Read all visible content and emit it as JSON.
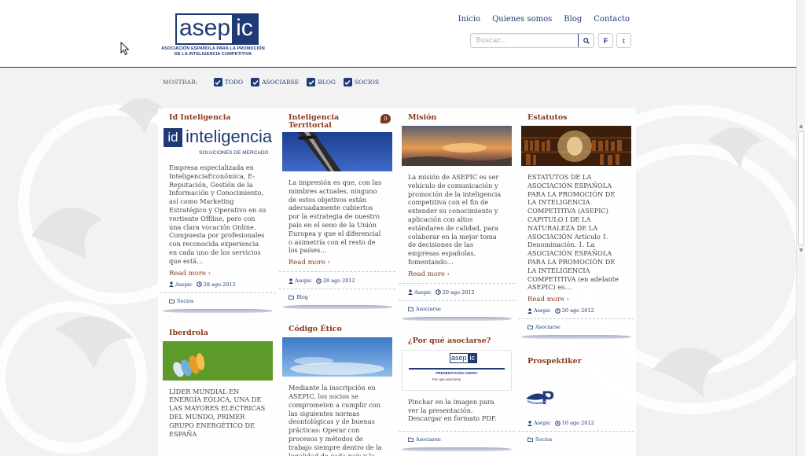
{
  "logo": {
    "part1": "asep",
    "part2": "ic",
    "subtitle": "ASOCIACIÓN ESPAÑOLA PARA LA PROMOCIÓN DE LA INTELIGENCIA COMPETITIVA"
  },
  "nav": {
    "items": [
      "Inicio",
      "Quienes somos",
      "Blog",
      "Contacto"
    ]
  },
  "search": {
    "placeholder": "Buscar..."
  },
  "social": {
    "facebook": "F",
    "twitter": "t"
  },
  "filters": {
    "label": "MOSTRAR:",
    "options": [
      "TODO",
      "ASOCIARSE",
      "BLOG",
      "SOCIOS"
    ]
  },
  "colors": {
    "brand": "#1f3a75",
    "title": "#8b3a1e"
  },
  "cards": {
    "id_inteligencia": {
      "title": "Id Inteligencia",
      "logo_id": "id",
      "logo_main": "inteligencia",
      "logo_sub": "SOLUCIONES DE MERCADO",
      "text": "Empresa especializada en InteligenciaEconómica, E-Reputación, Gestión de la Información y Conocimiento, así como Marketing Estratégico y Operativo en su vertiente Offline, pero con una clara vocación Online. Compuesta por profesionales con reconocida experiencia en cada uno de los servicios que está…",
      "readmore": "Read more ›",
      "author": "Asepic",
      "date": "28 ago 2012",
      "category": "Socios"
    },
    "iberdrola": {
      "title": "Iberdrola",
      "text": "LÍDER MUNDIAL EN ENERGÍA EÓLICA, UNA DE LAS MAYORES ELECTRICAS DEL MUNDO, PRIMER GRUPO ENERGÉTICO DE ESPAÑA"
    },
    "inteligencia_territorial": {
      "title": "Inteligencia Territorial",
      "comments": "0",
      "text": "La impresión es que, con las mimbres actuales, ninguno de estos objetivos están adecuadamente cubiertos por la estrategia de nuestro país en el seno de la Unión Europea y que el diferencial o asimetría con el resto de los países…",
      "readmore": "Read more ›",
      "author": "Asepic",
      "date": "28 ago 2012",
      "category": "Blog"
    },
    "codigo_etico": {
      "title": "Código Ético",
      "text": "Mediante la inscripción en ASEPIC, los socios se comprometen a cumplir con las siguientes normas deontológicas y de buenas prácticas: Operar con procesos y métodos de trabajo siempre dentro de la legalidad de cada país y la"
    },
    "mision": {
      "title": "Misión",
      "text": "La misión de ASEPIC es ser vehículo de comunicación y promoción de la inteligencia competitiva con el fin de extender su conocimiento y aplicación con altos estándares de calidad, para colaborar en la mejor toma de decisiones de las empresas españolas, fomentando…",
      "readmore": "Read more ›",
      "author": "Asepic",
      "date": "20 ago 2012",
      "category": "Asociarse"
    },
    "por_que": {
      "title": "¿Por qué asociarse?",
      "img_logo_a": "asep",
      "img_logo_b": "ic",
      "img_caption": "PRESENTACIÓN ASEPIC",
      "img_sub": "Por qué asociarse",
      "text": "Pinchar en la imagen para ver la presentación. Descargar en formato PDF.",
      "category": "Asociarse"
    },
    "estatutos": {
      "title": "Estatutos",
      "text": "ESTATUTOS DE LA ASOCIACIÓN ESPAÑOLA PARA LA PROMOCIÓN DE LA INTELIGENCIA COMPETITIVA (ASEPIC) CAPITULO I DE LA NATURALEZA DE LA ASOCIACIÓN   Artículo 1. Denominación. 1. La ASOCIACIÓN ESPAÑOLA PARA LA PROMOCIÓN DE LA INTELIGENCIA COMPETITIVA (en adelante ASEPIC) es…",
      "readmore": "Read more ›",
      "author": "Asepic",
      "date": "20 ago 2012",
      "category": "Asociarse"
    },
    "prospektiker": {
      "title": "Prospektiker",
      "author": "Asepic",
      "date": "10 ago 2012",
      "category": "Socios"
    }
  }
}
